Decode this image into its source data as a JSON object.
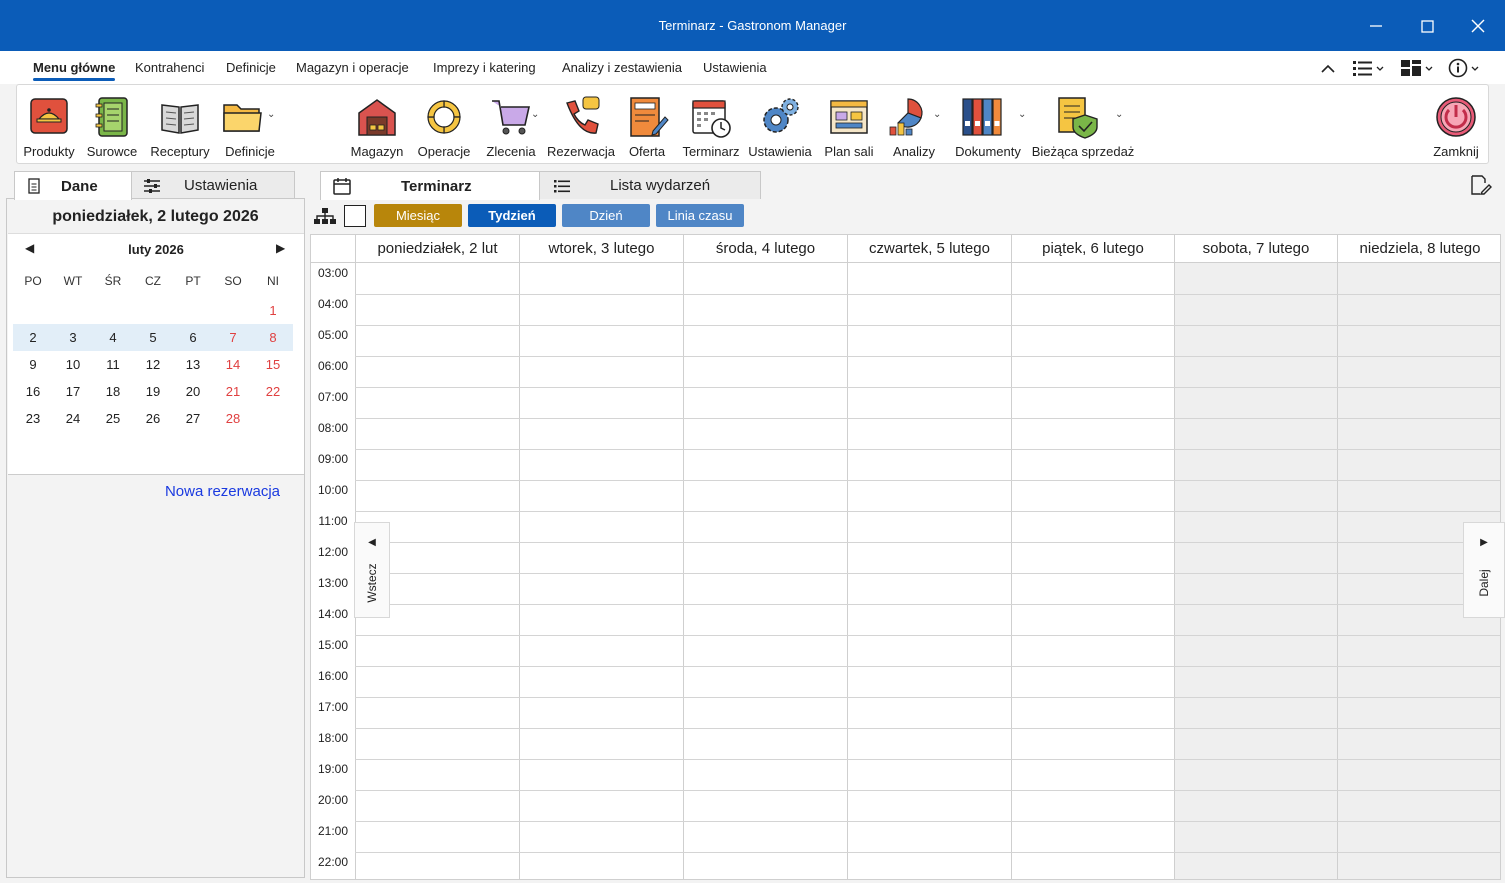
{
  "window": {
    "title": "Terminarz - Gastronom Manager"
  },
  "ribbon_tabs": [
    {
      "label": "Menu główne",
      "active": true
    },
    {
      "label": "Kontrahenci"
    },
    {
      "label": "Definicje"
    },
    {
      "label": "Magazyn i operacje"
    },
    {
      "label": "Imprezy i katering"
    },
    {
      "label": "Analizy i zestawienia"
    },
    {
      "label": "Ustawienia"
    }
  ],
  "ribbon_buttons": [
    {
      "label": "Produkty",
      "icon": "food-tray-icon"
    },
    {
      "label": "Surowce",
      "icon": "notebook-icon"
    },
    {
      "label": "Receptury",
      "icon": "open-book-icon"
    },
    {
      "label": "Definicje",
      "icon": "folder-icon"
    },
    {
      "label": "Magazyn",
      "icon": "warehouse-icon"
    },
    {
      "label": "Operacje",
      "icon": "cycle-arrows-icon"
    },
    {
      "label": "Zlecenia",
      "icon": "shopping-cart-icon"
    },
    {
      "label": "Rezerwacja",
      "icon": "phone-call-icon"
    },
    {
      "label": "Oferta",
      "icon": "offer-document-icon"
    },
    {
      "label": "Terminarz",
      "icon": "calendar-clock-icon"
    },
    {
      "label": "Ustawienia",
      "icon": "gears-icon"
    },
    {
      "label": "Plan sali",
      "icon": "floor-plan-icon"
    },
    {
      "label": "Analizy",
      "icon": "chart-icon"
    },
    {
      "label": "Dokumenty",
      "icon": "binders-icon"
    },
    {
      "label": "Bieżąca sprzedaż",
      "icon": "shield-document-icon"
    },
    {
      "label": "Zamknij",
      "icon": "power-icon"
    }
  ],
  "left_tabs": {
    "data": "Dane",
    "settings": "Ustawienia"
  },
  "selected_date": "poniedziałek, 2 lutego 2026",
  "calendar": {
    "month": "luty 2026",
    "weekdays": [
      "PO",
      "WT",
      "ŚR",
      "CZ",
      "PT",
      "SO",
      "NI"
    ],
    "weeks": [
      [
        "",
        "",
        "",
        "",
        "",
        "",
        "1"
      ],
      [
        "2",
        "3",
        "4",
        "5",
        "6",
        "7",
        "8"
      ],
      [
        "9",
        "10",
        "11",
        "12",
        "13",
        "14",
        "15"
      ],
      [
        "16",
        "17",
        "18",
        "19",
        "20",
        "21",
        "22"
      ],
      [
        "23",
        "24",
        "25",
        "26",
        "27",
        "28",
        ""
      ]
    ],
    "selected_week_index": 1,
    "weekend_color": "#e04040"
  },
  "new_reservation": "Nowa rezerwacja",
  "right_tabs": {
    "schedule": "Terminarz",
    "events": "Lista wydarzeń"
  },
  "views": [
    {
      "label": "Miesiąc",
      "color": "#b8860b"
    },
    {
      "label": "Tydzień",
      "color": "#0b5cb8",
      "active": true
    },
    {
      "label": "Dzień",
      "color": "#4f86c6"
    },
    {
      "label": "Linia czasu",
      "color": "#4f86c6"
    }
  ],
  "days": [
    {
      "label": "poniedziałek, 2 lut",
      "weekend": false
    },
    {
      "label": "wtorek, 3 lutego",
      "weekend": false
    },
    {
      "label": "środa, 4 lutego",
      "weekend": false
    },
    {
      "label": "czwartek, 5 lutego",
      "weekend": false
    },
    {
      "label": "piątek, 6 lutego",
      "weekend": false
    },
    {
      "label": "sobota, 7 lutego",
      "weekend": true
    },
    {
      "label": "niedziela, 8 lutego",
      "weekend": true
    }
  ],
  "hours": [
    "03:00",
    "04:00",
    "05:00",
    "06:00",
    "07:00",
    "08:00",
    "09:00",
    "10:00",
    "11:00",
    "12:00",
    "13:00",
    "14:00",
    "15:00",
    "16:00",
    "17:00",
    "18:00",
    "19:00",
    "20:00",
    "21:00",
    "22:00"
  ],
  "nav": {
    "back": "Wstecz",
    "next": "Dalej"
  }
}
